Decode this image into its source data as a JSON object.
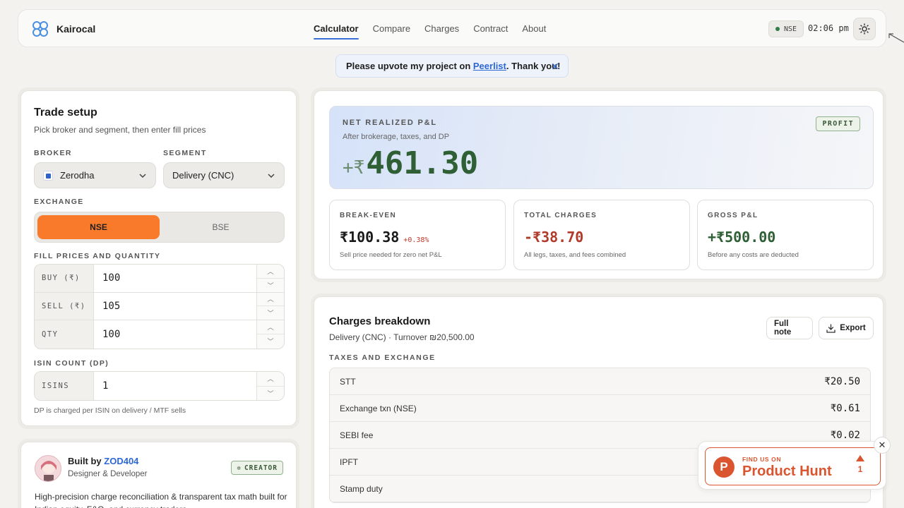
{
  "app": {
    "name": "Kairocal"
  },
  "nav": {
    "items": [
      {
        "label": "Calculator",
        "active": true
      },
      {
        "label": "Compare"
      },
      {
        "label": "Charges"
      },
      {
        "label": "Contract"
      },
      {
        "label": "About"
      }
    ]
  },
  "status": {
    "market": "NSE",
    "time": "02:06 pm"
  },
  "banner": {
    "prefix": "Please upvote my project on ",
    "link": "Peerlist",
    "suffix": ". Thank you!"
  },
  "trade_setup": {
    "title": "Trade setup",
    "subtitle": "Pick broker and segment, then enter fill prices",
    "broker_label": "BROKER",
    "broker_value": "Zerodha",
    "segment_label": "SEGMENT",
    "segment_value": "Delivery (CNC)",
    "exchange_label": "EXCHANGE",
    "exchange_options": [
      "NSE",
      "BSE"
    ],
    "exchange_selected": "NSE",
    "fill_label": "FILL PRICES AND QUANTITY",
    "fields": [
      {
        "label": "BUY (₹)",
        "value": "100"
      },
      {
        "label": "SELL (₹)",
        "value": "105"
      },
      {
        "label": "QTY",
        "value": "100"
      }
    ],
    "isin_label": "ISIN COUNT (DP)",
    "isin_field": {
      "label": "ISINS",
      "value": "1"
    },
    "dp_hint": "DP is charged per ISIN on delivery / MTF sells"
  },
  "creator": {
    "prefix": "Built by ",
    "name": "ZOD404",
    "role": "Designer & Developer",
    "badge": "CREATOR",
    "description": "High-precision charge reconciliation & transparent tax math built for Indian equity, F&O, and currency traders."
  },
  "pnl": {
    "label": "NET REALIZED P&L",
    "subtitle": "After brokerage, taxes, and DP",
    "prefix": "+₹",
    "value": "461.30",
    "tag": "PROFIT",
    "accent": "#2f5f35"
  },
  "stats": [
    {
      "label": "BREAK-EVEN",
      "value": "₹100.38",
      "delta": "+0.38%",
      "note": "Sell price needed for zero net P&L",
      "color": "#1a1a1a"
    },
    {
      "label": "TOTAL CHARGES",
      "value": "-₹38.70",
      "note": "All legs, taxes, and fees combined",
      "color": "#b13a2a"
    },
    {
      "label": "GROSS P&L",
      "value": "+₹500.00",
      "note": "Before any costs are deducted",
      "color": "#2f5f35"
    }
  ],
  "charges": {
    "title": "Charges breakdown",
    "subtitle": "Delivery (CNC) · Turnover ₪20,500.00",
    "full_note_label": "Full note",
    "export_label": "Export",
    "section": "TAXES AND EXCHANGE",
    "rows": [
      {
        "name": "STT",
        "amount": "₹20.50"
      },
      {
        "name": "Exchange txn (NSE)",
        "amount": "₹0.61"
      },
      {
        "name": "SEBI fee",
        "amount": "₹0.02"
      },
      {
        "name": "IPFT",
        "amount": ""
      },
      {
        "name": "Stamp duty",
        "amount": ""
      }
    ]
  },
  "product_hunt": {
    "small": "FIND US ON",
    "big": "Product Hunt",
    "votes": "1"
  }
}
